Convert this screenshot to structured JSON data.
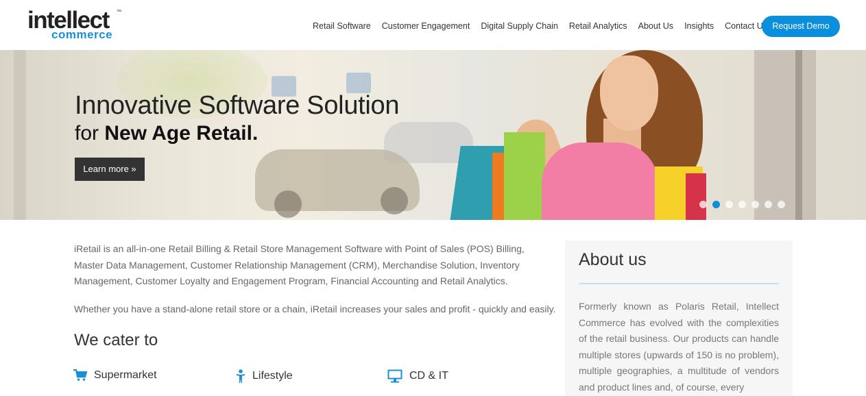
{
  "logo": {
    "main": "intellect",
    "tm": "™",
    "sub": "commerce"
  },
  "nav": {
    "items": [
      "Retail Software",
      "Customer Engagement",
      "Digital Supply Chain",
      "Retail Analytics",
      "About Us",
      "Insights",
      "Contact Us"
    ],
    "cta": "Request Demo"
  },
  "hero": {
    "title_line1": "Innovative Software Solution",
    "title_line2_pre": "for ",
    "title_line2_bold": "New Age Retail.",
    "button": "Learn more »",
    "slides_total": 7,
    "slide_active": 2
  },
  "main": {
    "intro": "iRetail is an all-in-one Retail Billing & Retail Store Management Software with Point of Sales (POS) Billing, Master Data Management, Customer Relationship Management (CRM), Merchandise Solution, Inventory Management, Customer Loyalty and Engagement Program, Financial Accounting and Retail Analytics.",
    "intro2": "Whether you have a stand-alone retail store or a chain, iRetail increases your sales and profit - quickly and easily.",
    "cater_heading": "We cater to",
    "categories": [
      {
        "label": "Supermarket",
        "icon": "cart-icon"
      },
      {
        "label": "Lifestyle",
        "icon": "person-icon"
      },
      {
        "label": "CD & IT",
        "icon": "monitor-icon"
      }
    ]
  },
  "about": {
    "title": "About us",
    "text": "Formerly known as Polaris Retail, Intellect Commerce has evolved with the complexities of the retail business. Our products can handle multiple stores (upwards of 150 is no problem), multiple geographies, a multitude of vendors and product lines and, of course, every"
  },
  "colors": {
    "accent": "#0b8fdc",
    "dark_button": "#333333",
    "about_bg": "#f6f6f6"
  }
}
